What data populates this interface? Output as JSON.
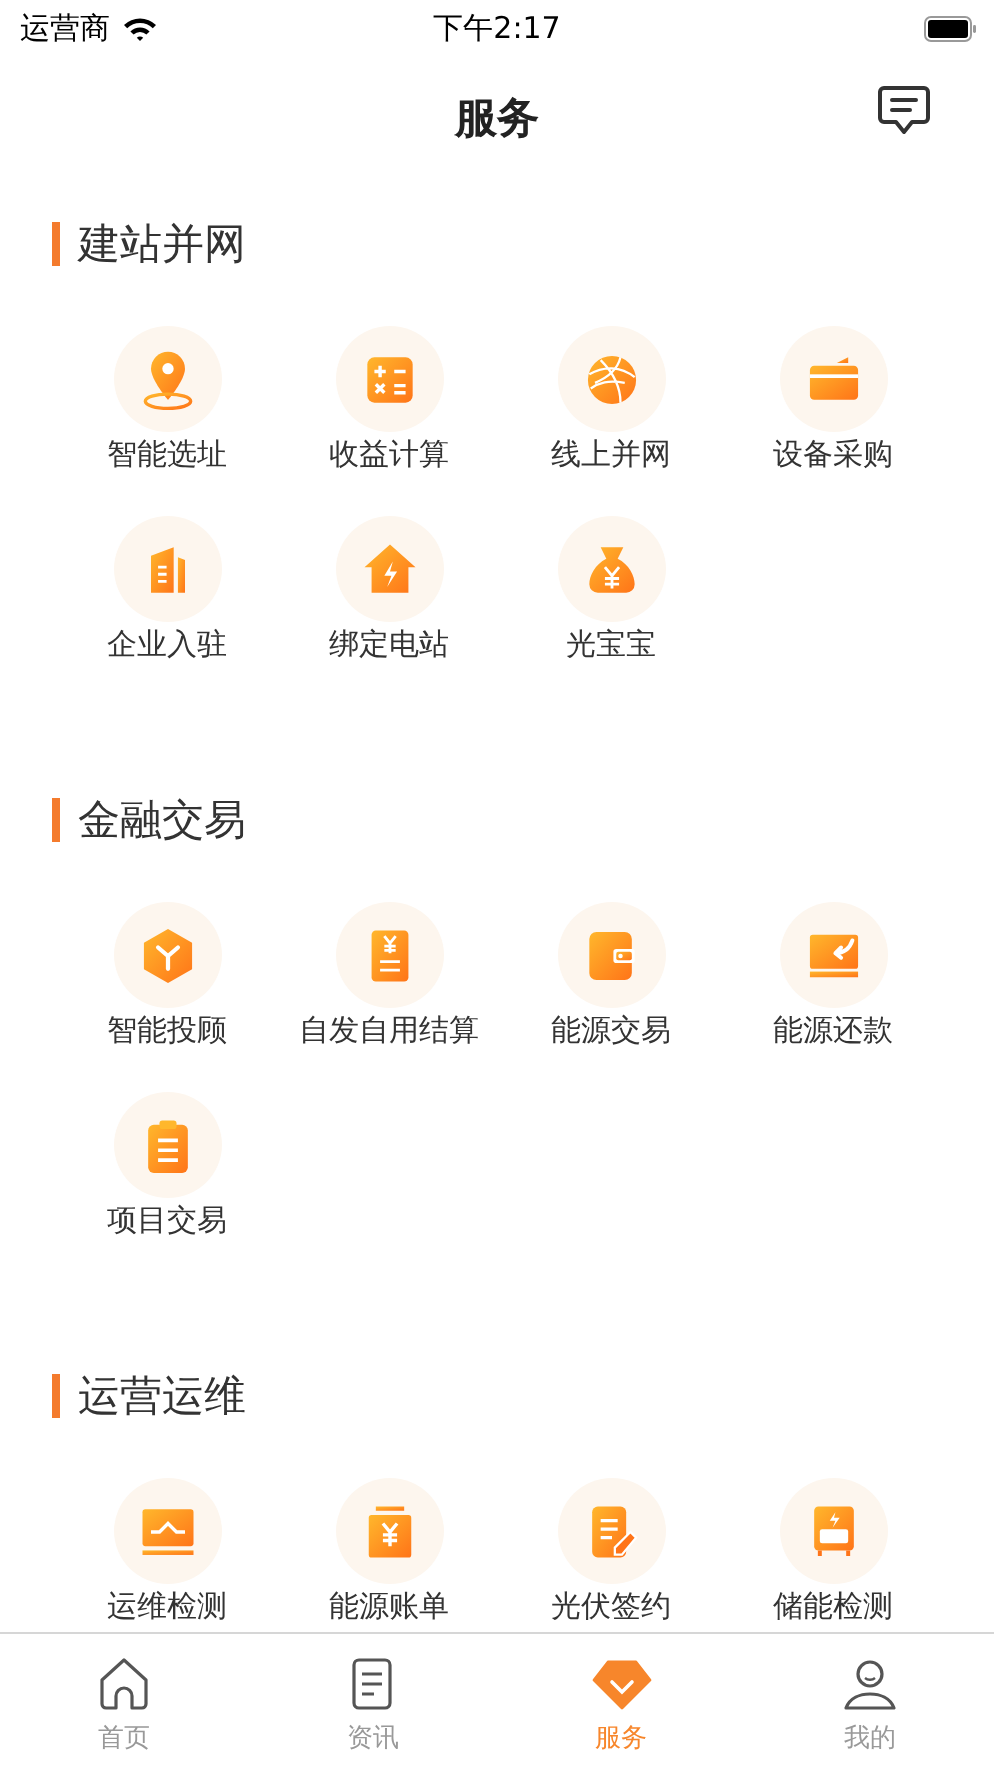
{
  "status_bar": {
    "carrier": "运营商",
    "time": "下午2:17"
  },
  "nav": {
    "title": "服务"
  },
  "sections": [
    {
      "title": "建站并网",
      "items": [
        {
          "label": "智能选址"
        },
        {
          "label": "收益计算"
        },
        {
          "label": "线上并网"
        },
        {
          "label": "设备采购"
        },
        {
          "label": "企业入驻"
        },
        {
          "label": "绑定电站"
        },
        {
          "label": "光宝宝"
        }
      ]
    },
    {
      "title": "金融交易",
      "items": [
        {
          "label": "智能投顾"
        },
        {
          "label": "自发自用结算"
        },
        {
          "label": "能源交易"
        },
        {
          "label": "能源还款"
        },
        {
          "label": "项目交易"
        }
      ]
    },
    {
      "title": "运营运维",
      "items": [
        {
          "label": "运维检测"
        },
        {
          "label": "能源账单"
        },
        {
          "label": "光伏签约"
        },
        {
          "label": "储能检测"
        }
      ]
    }
  ],
  "tab_bar": [
    {
      "label": "首页",
      "selected": false
    },
    {
      "label": "资讯",
      "selected": false
    },
    {
      "label": "服务",
      "selected": true
    },
    {
      "label": "我的",
      "selected": false
    }
  ]
}
